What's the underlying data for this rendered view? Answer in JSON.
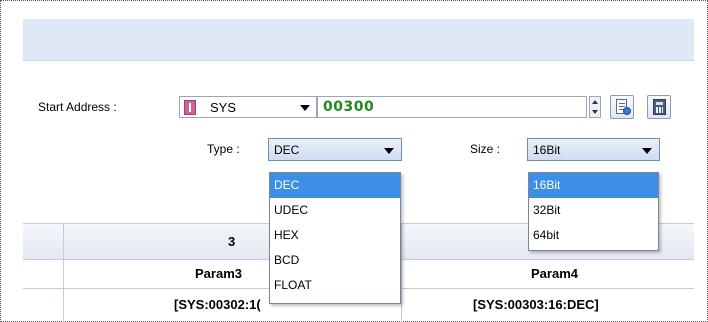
{
  "form": {
    "start_address_label": "Start Address :",
    "device": "SYS",
    "address_value": "00300",
    "type_label": "Type :",
    "size_label": "Size :",
    "type_value": "DEC",
    "size_value": "16Bit"
  },
  "type_dropdown": {
    "options": [
      "DEC",
      "UDEC",
      "HEX",
      "BCD",
      "FLOAT"
    ],
    "selected": "DEC"
  },
  "size_dropdown": {
    "options": [
      "16Bit",
      "32Bit",
      "64bit"
    ],
    "selected": "16Bit"
  },
  "table": {
    "col3_header": "3",
    "col3_param": "Param3",
    "col3_addr": "[SYS:00302:1(",
    "col4_param": "Param4",
    "col4_addr": "[SYS:00303:16:DEC]"
  },
  "colors": {
    "address_text": "#1f8a1f",
    "selection": "#3d8ee6",
    "band": "#dfe8f5",
    "device_badge": "#d4609a"
  },
  "icons": [
    "spinner-icon",
    "document-icon",
    "calculator-icon"
  ]
}
